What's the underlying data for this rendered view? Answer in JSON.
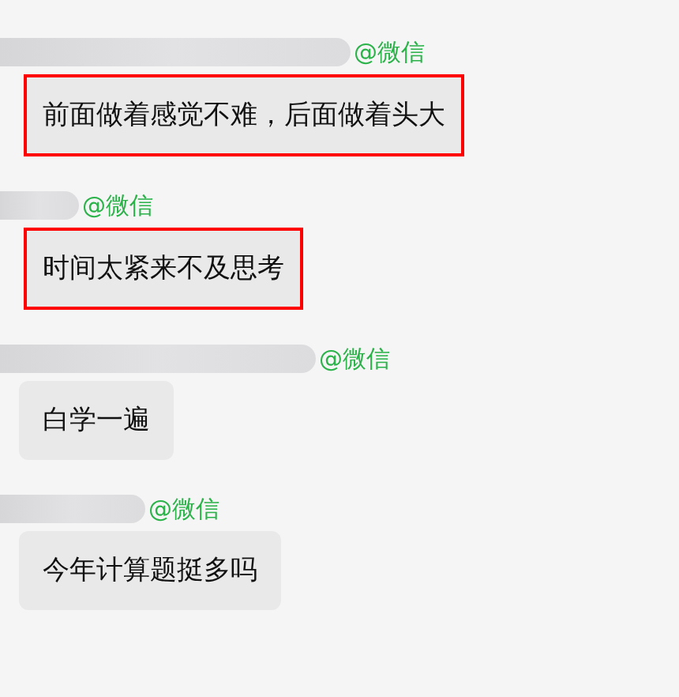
{
  "messages": [
    {
      "sender_suffix": "@微信",
      "text": "前面做着感觉不难，后面做着头大",
      "highlighted": true
    },
    {
      "sender_suffix": "@微信",
      "text": "时间太紧来不及思考",
      "highlighted": true
    },
    {
      "sender_suffix": "@微信",
      "text": "白学一遍",
      "highlighted": false
    },
    {
      "sender_suffix": "@微信",
      "text": "今年计算题挺多吗",
      "highlighted": false
    }
  ]
}
